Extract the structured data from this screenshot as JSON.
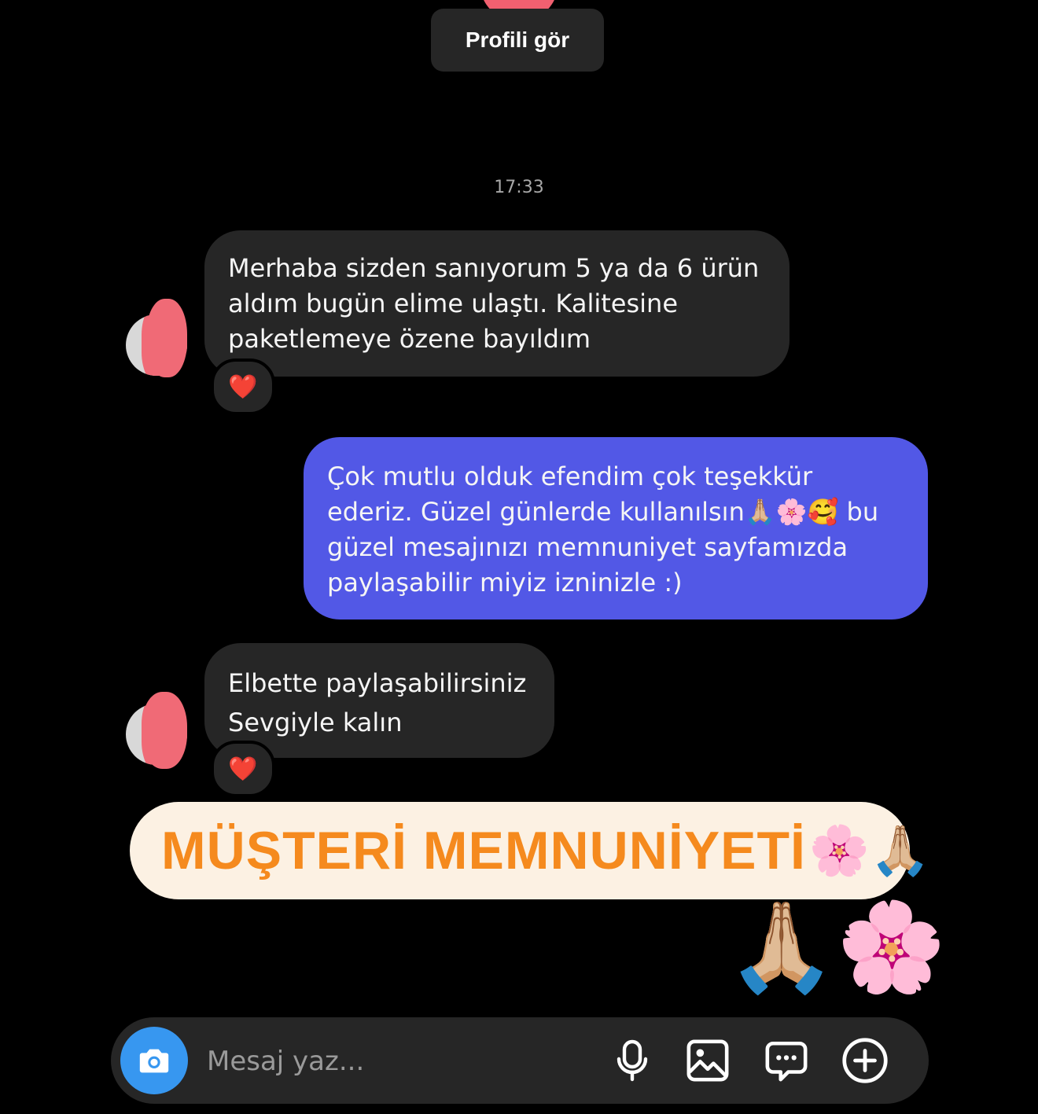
{
  "header": {
    "profile_button_label": "Profili gör"
  },
  "conversation": {
    "timestamp": "17:33",
    "messages": [
      {
        "direction": "incoming",
        "text": "Merhaba sizden sanıyorum 5 ya da 6 ürün\naldım bugün elime ulaştı. Kalitesine\npaketlemeye özene bayıldım",
        "reaction": "❤️"
      },
      {
        "direction": "outgoing",
        "text": "Çok mutlu olduk efendim çok teşekkür\nederiz. Güzel günlerde kullanılsın🙏🏼🌸🥰 bu\ngüzel mesajınızı memnuniyet sayfamızda\npaylaşabilir miyiz izninizle :)"
      },
      {
        "direction": "incoming",
        "text": "Elbette paylaşabilirsiniz\nSevgiyle kalın",
        "reaction": "❤️"
      }
    ]
  },
  "banner": {
    "text": "MÜŞTERİ MEMNUNİYETİ",
    "emojis": "🌸🙏🏼"
  },
  "sticker": {
    "emojis": "🙏🏼🌸"
  },
  "composer": {
    "placeholder": "Mesaj yaz...",
    "icons": [
      "camera-icon",
      "microphone-icon",
      "gallery-icon",
      "sticker-chat-icon",
      "plus-icon"
    ]
  },
  "colors": {
    "background": "#000000",
    "incoming_bubble": "#262626",
    "outgoing_bubble": "#5258e6",
    "banner_background": "#fcf1e3",
    "banner_text": "#f58a1e",
    "camera_button": "#3797f0"
  }
}
